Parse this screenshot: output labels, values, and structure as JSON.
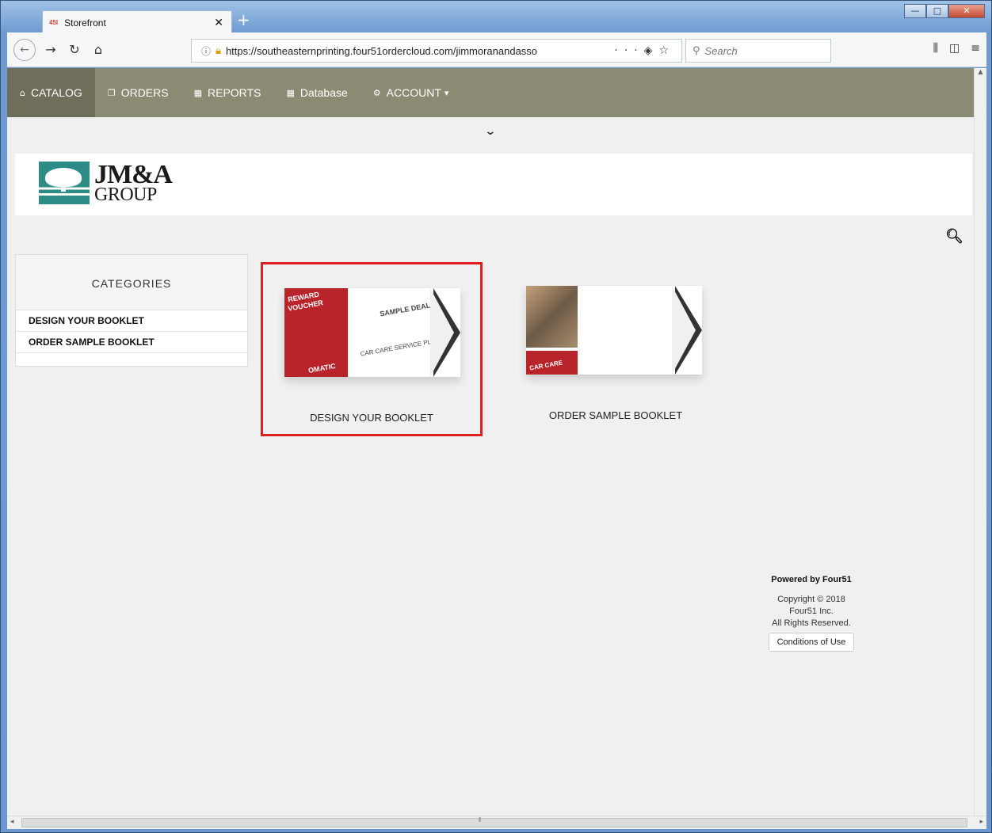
{
  "browser": {
    "tab_title": "Storefront",
    "tab_favicon": "45I",
    "url": "https://southeasternprinting.four51ordercloud.com/jimmoranandasso",
    "search_placeholder": "Search",
    "page_actions_icon": "ellipsis-icon"
  },
  "nav": {
    "items": [
      {
        "label": "CATALOG",
        "icon": "home-icon"
      },
      {
        "label": "ORDERS",
        "icon": "copy-icon"
      },
      {
        "label": "REPORTS",
        "icon": "bar-chart-icon"
      },
      {
        "label": "Database",
        "icon": "bar-chart-icon"
      },
      {
        "label": "ACCOUNT",
        "icon": "gear-icon"
      }
    ],
    "account_caret": "▾"
  },
  "logo": {
    "line1": "JM&A",
    "line2": "GROUP"
  },
  "sidebar": {
    "header": "CATEGORIES",
    "items": [
      {
        "label": "DESIGN YOUR BOOKLET"
      },
      {
        "label": "ORDER SAMPLE BOOKLET"
      }
    ]
  },
  "products": [
    {
      "label": "DESIGN YOUR BOOKLET",
      "selected": true
    },
    {
      "label": "ORDER SAMPLE BOOKLET",
      "selected": false
    }
  ],
  "product_image_text": {
    "p1_reward": "REWARD",
    "p1_voucher": "VOUCHER",
    "p1_sample": "SAMPLE DEAL",
    "p1_plan": "CAR CARE SERVICE PLAN",
    "p1_auto": "OMATIC",
    "p2_care": "CAR CARE"
  },
  "footer": {
    "powered_by": "Powered by Four51",
    "copyright_line1": "Copyright © 2018",
    "copyright_line2": "Four51 Inc.",
    "copyright_line3": "All Rights Reserved.",
    "conditions_label": "Conditions of Use"
  },
  "colors": {
    "nav_bg": "#8b8b73",
    "nav_active": "#6e6e5a",
    "selection_border": "#e02020"
  }
}
